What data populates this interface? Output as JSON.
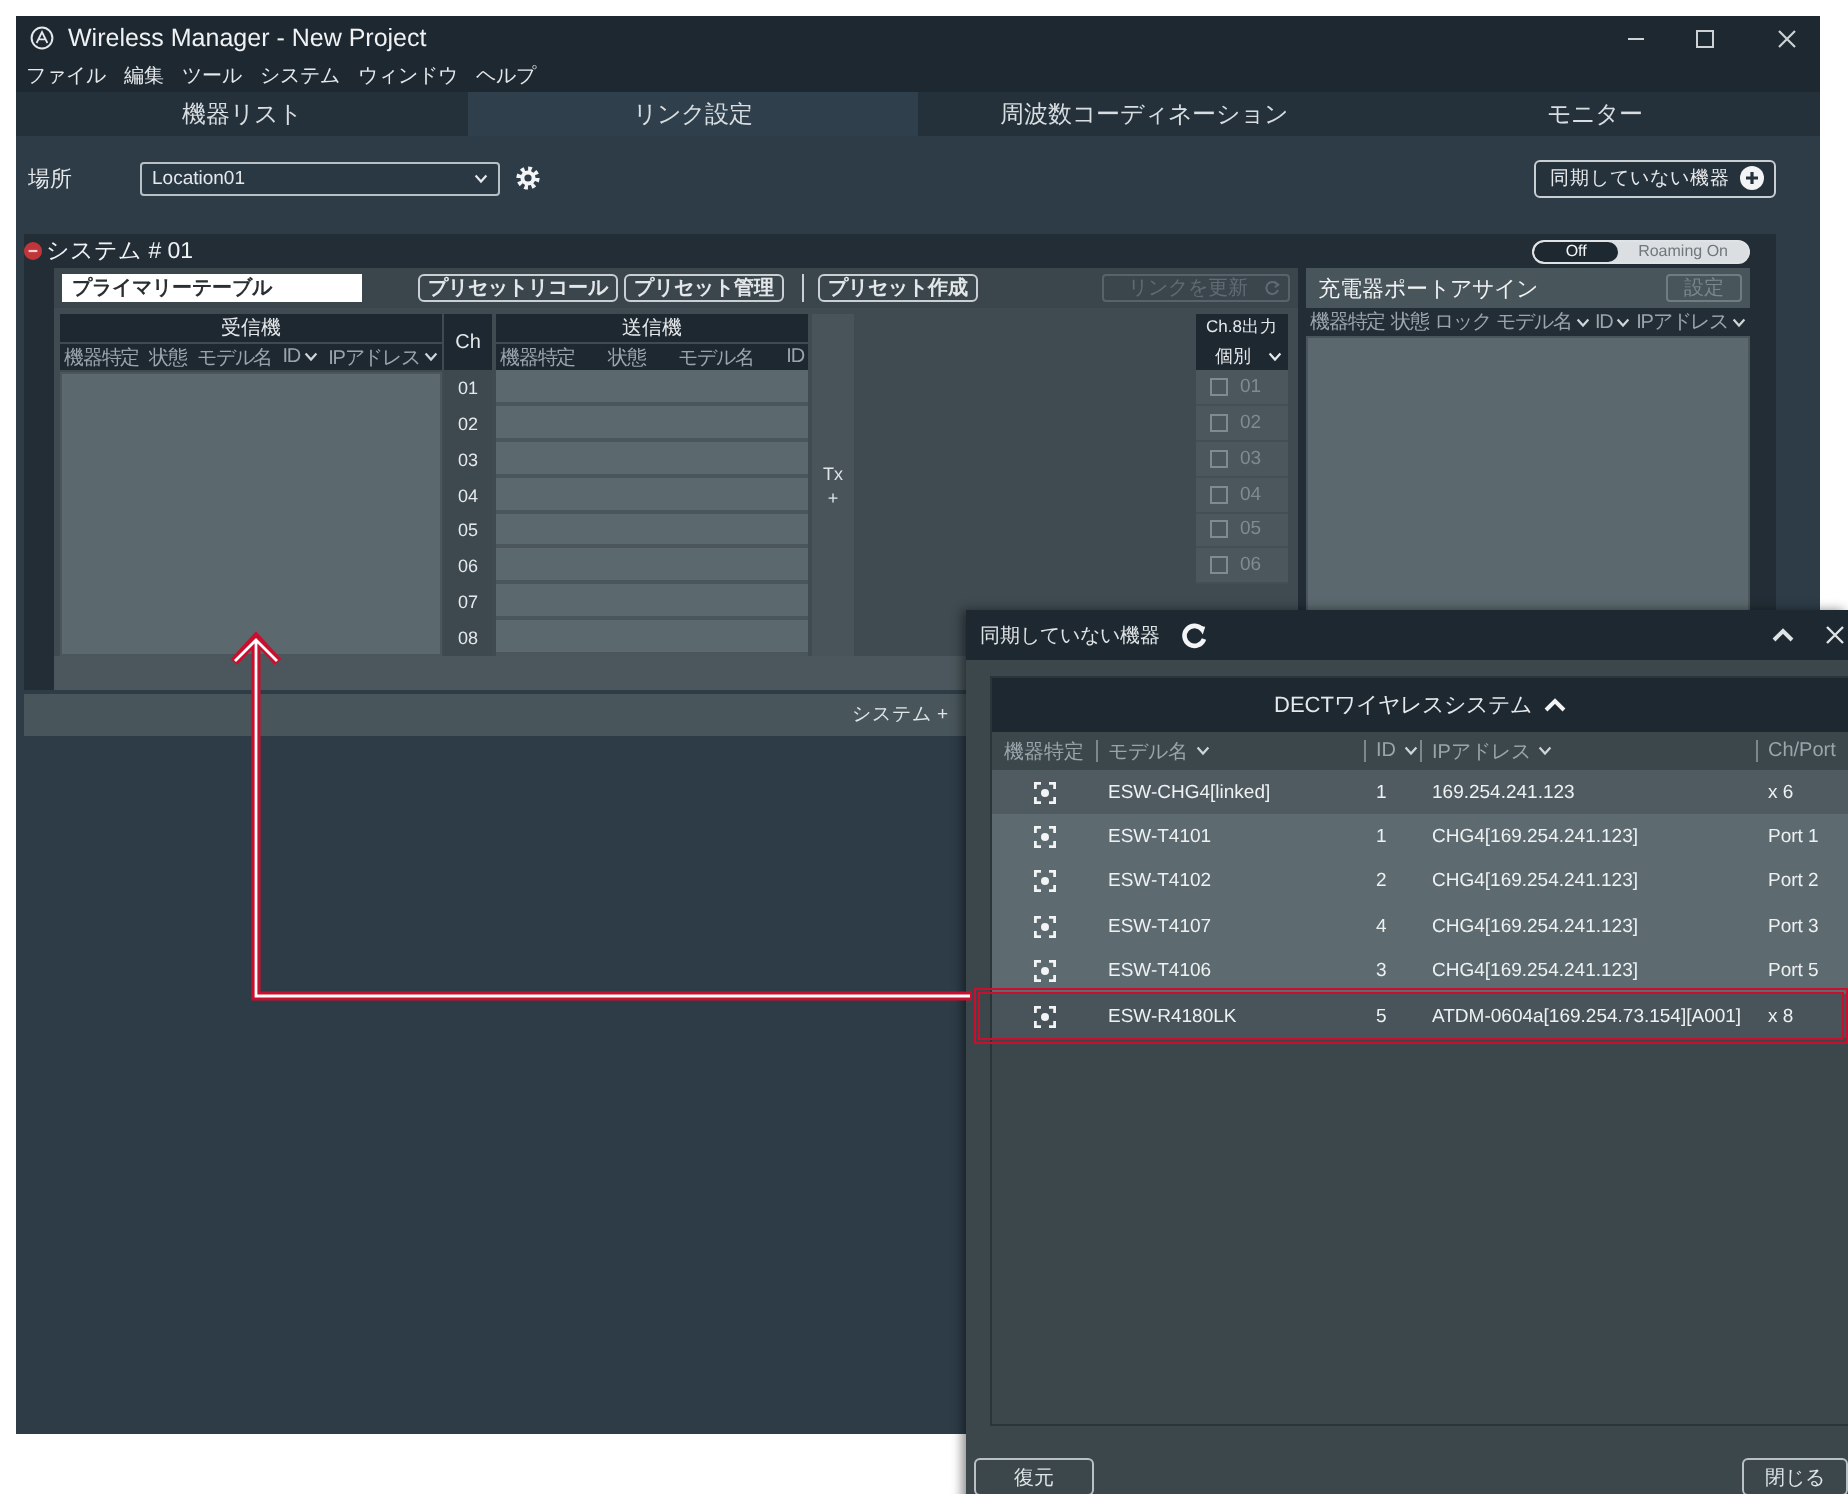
{
  "window": {
    "title": "Wireless Manager - New Project"
  },
  "menu": [
    "ファイル",
    "編集",
    "ツール",
    "システム",
    "ウィンドウ",
    "ヘルプ"
  ],
  "tabs": [
    {
      "label": "機器リスト",
      "selected": false
    },
    {
      "label": "リンク設定",
      "selected": true
    },
    {
      "label": "周波数コーディネーション",
      "selected": false
    },
    {
      "label": "モニター",
      "selected": false
    }
  ],
  "location": {
    "label": "場所",
    "value": "Location01"
  },
  "unsynced_button": "同期していない機器",
  "system": {
    "title": "システム # 01",
    "roaming": [
      {
        "label": "Off",
        "selected": true
      },
      {
        "label": "Roaming On",
        "selected": false
      }
    ],
    "table_name": "プライマリーテーブル",
    "preset_buttons": [
      "プリセットリコール",
      "プリセット管理",
      "プリセット作成"
    ],
    "refresh_link": {
      "label": "リンクを更新",
      "disabled": true
    },
    "receiver": {
      "title": "受信機",
      "columns": [
        {
          "label": "機器特定",
          "sortable": false
        },
        {
          "label": "状態",
          "sortable": false
        },
        {
          "label": "モデル名",
          "sortable": false
        },
        {
          "label": "ID",
          "sortable": true
        },
        {
          "label": "IPアドレス",
          "sortable": true
        }
      ]
    },
    "ch_header": "Ch",
    "channels": [
      "01",
      "02",
      "03",
      "04",
      "05",
      "06",
      "07",
      "08"
    ],
    "transmitter": {
      "title": "送信機",
      "columns": [
        {
          "label": "機器特定",
          "sortable": false
        },
        {
          "label": "状態",
          "sortable": false
        },
        {
          "label": "モデル名",
          "sortable": false
        },
        {
          "label": "ID",
          "sortable": false
        }
      ]
    },
    "tx_add": {
      "label": "Tx",
      "plus": "+"
    },
    "ch8_output": {
      "title": "Ch.8出力",
      "mode": "個別",
      "items": [
        {
          "label": "01",
          "checked": false
        },
        {
          "label": "02",
          "checked": false
        },
        {
          "label": "03",
          "checked": false
        },
        {
          "label": "04",
          "checked": false
        },
        {
          "label": "05",
          "checked": false
        },
        {
          "label": "06",
          "checked": false
        }
      ]
    },
    "charger": {
      "title": "充電器ポートアサイン",
      "button": {
        "label": "設定",
        "disabled": true
      },
      "columns": [
        {
          "label": "機器特定",
          "sortable": false
        },
        {
          "label": "状態",
          "sortable": false
        },
        {
          "label": "ロック",
          "sortable": false
        },
        {
          "label": "モデル名",
          "sortable": true
        },
        {
          "label": "ID",
          "sortable": true
        },
        {
          "label": "IPアドレス",
          "sortable": true
        }
      ]
    }
  },
  "add_system": "システム +",
  "popup": {
    "title": "同期していない機器",
    "group": {
      "title": "DECTワイヤレスシステム",
      "expanded": true
    },
    "columns": [
      {
        "label": "機器特定",
        "sortable": false
      },
      {
        "label": "モデル名",
        "sortable": true
      },
      {
        "label": "ID",
        "sortable": true
      },
      {
        "label": "IPアドレス",
        "sortable": true
      },
      {
        "label": "Ch/Port",
        "sortable": false
      }
    ],
    "rows": [
      {
        "kind": "charger",
        "model": "ESW-CHG4[linked]",
        "id": "1",
        "ip": "169.254.241.123",
        "port": "x 6",
        "highlighted": false
      },
      {
        "kind": "transmitter",
        "model": "ESW-T4101",
        "id": "1",
        "ip": "CHG4[169.254.241.123]",
        "port": "Port 1",
        "highlighted": false
      },
      {
        "kind": "transmitter",
        "model": "ESW-T4102",
        "id": "2",
        "ip": "CHG4[169.254.241.123]",
        "port": "Port 2",
        "highlighted": false
      },
      {
        "kind": "transmitter",
        "model": "ESW-T4107",
        "id": "4",
        "ip": "CHG4[169.254.241.123]",
        "port": "Port 3",
        "highlighted": false
      },
      {
        "kind": "transmitter",
        "model": "ESW-T4106",
        "id": "3",
        "ip": "CHG4[169.254.241.123]",
        "port": "Port 5",
        "highlighted": false
      },
      {
        "kind": "receiver",
        "model": "ESW-R4180LK",
        "id": "5",
        "ip": "ATDM-0604a[169.254.73.154][A001]",
        "port": "x 8",
        "highlighted": true
      }
    ],
    "buttons": [
      "復元",
      "閉じる"
    ]
  }
}
